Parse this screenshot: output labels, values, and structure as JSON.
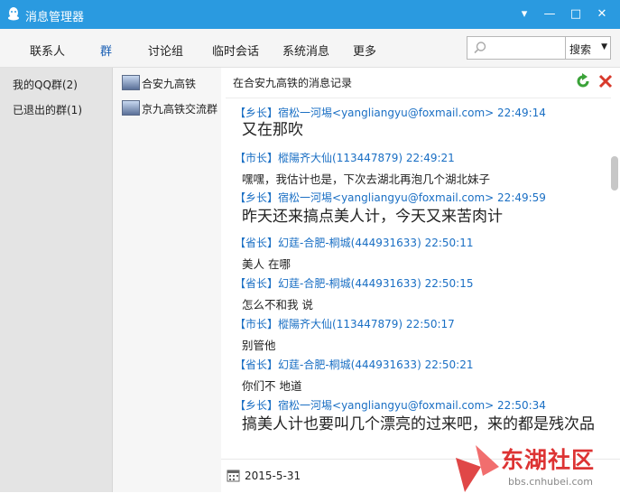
{
  "window": {
    "title": "消息管理器"
  },
  "tabs": [
    {
      "label": "联系人"
    },
    {
      "label": "群"
    },
    {
      "label": "讨论组"
    },
    {
      "label": "临时会话"
    },
    {
      "label": "系统消息"
    },
    {
      "label": "更多"
    }
  ],
  "search": {
    "placeholder": "",
    "scope_selected": "搜索"
  },
  "categories": [
    {
      "label": "我的QQ群(2)"
    },
    {
      "label": "已退出的群(1)"
    }
  ],
  "groups": [
    {
      "name": "合安九高铁"
    },
    {
      "name": "京九高铁交流群"
    }
  ],
  "content": {
    "header": "在合安九高铁的消息记录"
  },
  "messages": [
    {
      "rank": "【乡长】",
      "sender": "宿松一河埸<yangliangyu@foxmail.com>",
      "time": "22:49:14",
      "text": "又在那吹",
      "size": "large"
    },
    {
      "rank": "【市长】",
      "sender": "樅陽齐大仙(113447879)",
      "time": "22:49:21",
      "text": "嘿嘿，我估计也是，下次去湖北再泡几个湖北妹子",
      "size": "small"
    },
    {
      "rank": "【乡长】",
      "sender": "宿松一河埸<yangliangyu@foxmail.com>",
      "time": "22:49:59",
      "text": "昨天还来搞点美人计，今天又来苦肉计",
      "size": "large"
    },
    {
      "rank": "【省长】",
      "sender": "幻莛-合肥-桐城(444931633)",
      "time": "22:50:11",
      "text": "美人 在哪",
      "size": "small"
    },
    {
      "rank": "【省长】",
      "sender": "幻莛-合肥-桐城(444931633)",
      "time": "22:50:15",
      "text": "怎么不和我 说",
      "size": "small"
    },
    {
      "rank": "【市长】",
      "sender": "樅陽齐大仙(113447879)",
      "time": "22:50:17",
      "text": "别管他",
      "size": "small"
    },
    {
      "rank": "【省长】",
      "sender": "幻莛-合肥-桐城(444931633)",
      "time": "22:50:21",
      "text": "你们不 地道",
      "size": "small"
    },
    {
      "rank": "【乡长】",
      "sender": "宿松一河埸<yangliangyu@foxmail.com>",
      "time": "22:50:34",
      "text": "搞美人计也要叫几个漂亮的过来吧，来的都是残次品",
      "size": "large"
    }
  ],
  "date_bar": {
    "date": "2015-5-31"
  },
  "watermark": {
    "text": "东湖社区",
    "url": "bbs.cnhubei.com"
  },
  "colors": {
    "titlebar": "#2a9ae0",
    "accent": "#1a6fc4",
    "watermark": "#dd3333"
  }
}
